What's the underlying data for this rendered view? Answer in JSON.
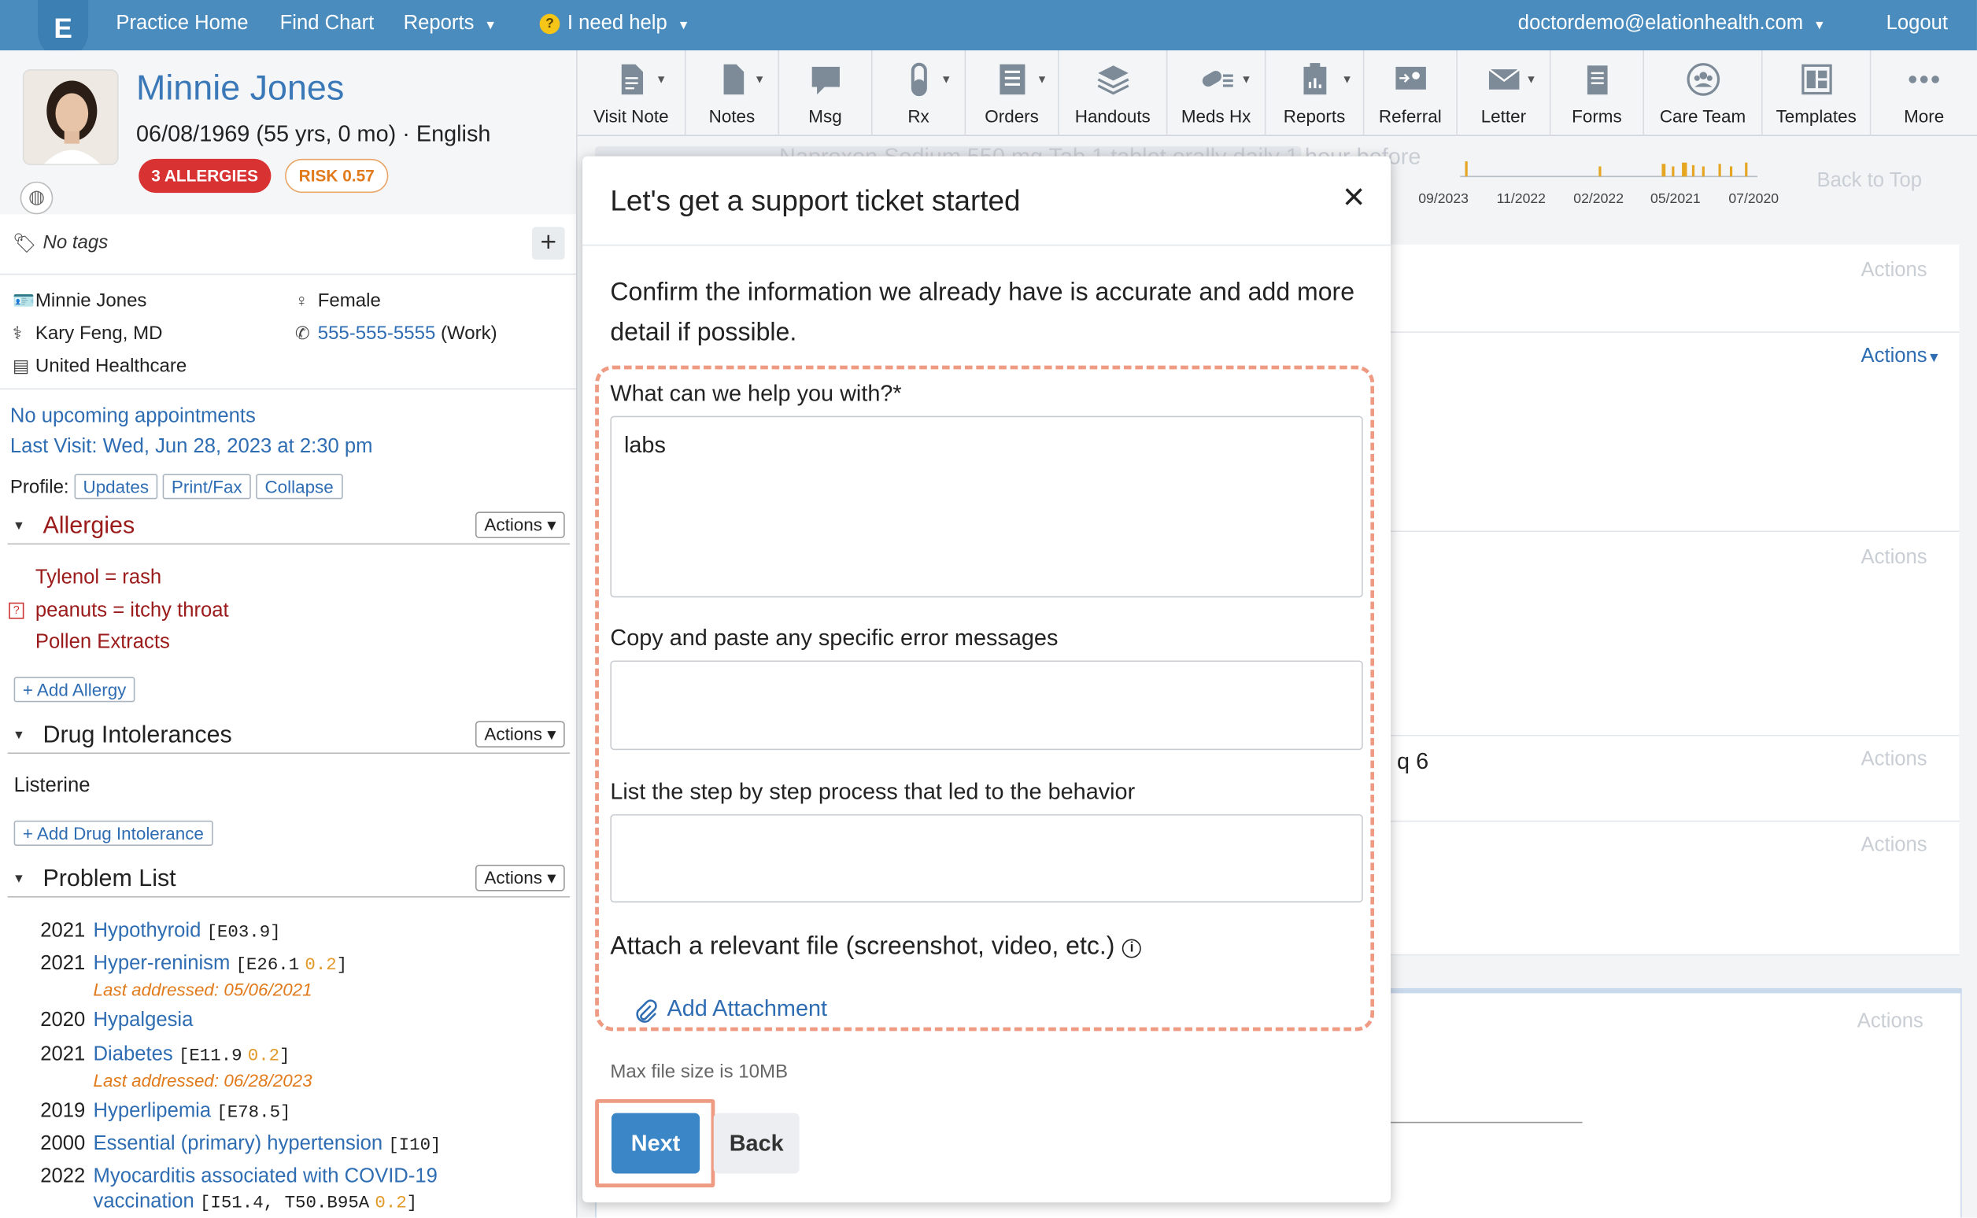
{
  "topnav": {
    "logo": "E",
    "items": [
      "Practice Home",
      "Find Chart",
      "Reports"
    ],
    "help": "I need help",
    "user_email": "doctordemo@elationhealth.com",
    "logout": "Logout"
  },
  "patient": {
    "name": "Minnie Jones",
    "dob_line": "06/08/1969 (55 yrs, 0 mo) · English",
    "allergy_badge": "3 ALLERGIES",
    "risk_badge": "RISK 0.57",
    "tags": "No tags",
    "full_name": "Minnie Jones",
    "sex": "Female",
    "provider": "Kary Feng, MD",
    "phone": "555-555-5555",
    "phone_type": "(Work)",
    "insurance": "United Healthcare",
    "appointments": "No upcoming appointments",
    "last_visit": "Last Visit: Wed, Jun 28, 2023 at 2:30 pm",
    "profile_label": "Profile:",
    "profile_buttons": [
      "Updates",
      "Print/Fax",
      "Collapse"
    ]
  },
  "sections": {
    "actions_label": "Actions",
    "allergies_title": "Allergies",
    "allergies": [
      "Tylenol = rash",
      "peanuts = itchy throat",
      "Pollen Extracts"
    ],
    "add_allergy": "+ Add Allergy",
    "intolerances_title": "Drug Intolerances",
    "intolerances": [
      "Listerine"
    ],
    "add_intolerance": "+ Add Drug Intolerance",
    "problems_title": "Problem List",
    "problems": [
      {
        "year": "2021",
        "name": "Hypothyroid",
        "code": "[E03.9]",
        "score": ""
      },
      {
        "year": "2021",
        "name": "Hyper-reninism",
        "code": "[E26.1",
        "score": "0.2",
        "close": "]",
        "last": "Last addressed: 05/06/2021"
      },
      {
        "year": "2020",
        "name": "Hypalgesia",
        "code": "",
        "score": ""
      },
      {
        "year": "2021",
        "name": "Diabetes",
        "code": "[E11.9",
        "score": "0.2",
        "close": "]",
        "last": "Last addressed: 06/28/2023"
      },
      {
        "year": "2019",
        "name": "Hyperlipemia",
        "code": "[E78.5]",
        "score": ""
      },
      {
        "year": "2000",
        "name": "Essential (primary) hypertension",
        "code": "[I10]",
        "score": ""
      },
      {
        "year": "2022",
        "name": "Myocarditis associated with COVID-19",
        "name2": "vaccination",
        "code": "[I51.4, T50.B95A",
        "score": "0.2",
        "close": "]"
      }
    ]
  },
  "toolbar": {
    "items": [
      "Visit Note",
      "Notes",
      "Msg",
      "Rx",
      "Orders",
      "Handouts",
      "Meds Hx",
      "Reports",
      "Referral",
      "Letter",
      "Forms",
      "Care Team",
      "Templates",
      "More"
    ]
  },
  "background": {
    "med_line": "Naproxen Sodium 550 mg Tab 1 tablet orally daily 1 hour before",
    "timeline": [
      "09/2023",
      "11/2022",
      "02/2022",
      "05/2021",
      "07/2020"
    ],
    "back_to_top": "Back to Top",
    "actions": "Actions",
    "actions_active": "Actions",
    "q6": "q 6"
  },
  "modal": {
    "title": "Let's get a support ticket started",
    "close": "×",
    "intro": "Confirm the information we already have is accurate and add more detail if possible.",
    "help_label": "What can we help you with?*",
    "help_value": "labs",
    "error_label": "Copy and paste any specific error messages",
    "error_value": "",
    "steps_label": "List the step by step process that led to the behavior",
    "steps_value": "",
    "attach_label": "Attach a relevant file (screenshot, video, etc.)",
    "attach_link": "Add Attachment",
    "max_size": "Max file size is 10MB",
    "next": "Next",
    "back": "Back"
  },
  "colors": {
    "brand_blue": "#4a8cbd",
    "link_blue": "#2f6db3",
    "allergy_red": "#d83232",
    "highlight": "#ef9a82",
    "primary_button": "#3b86c6"
  }
}
